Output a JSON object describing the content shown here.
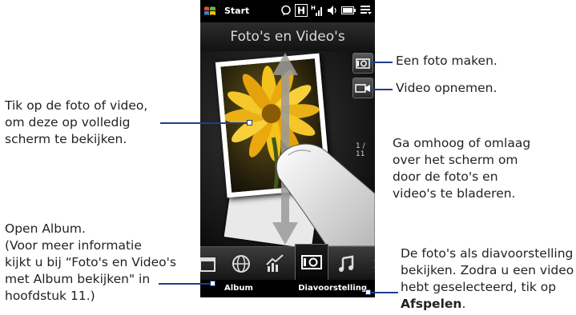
{
  "phone": {
    "status": {
      "start_label": "Start"
    },
    "title": "Foto's en Video's",
    "counter": "1 / 11",
    "softkeys": {
      "left": "Album",
      "right": "Diavoorstelling"
    }
  },
  "callouts": {
    "tap_photo": [
      "Tik op de foto of video,",
      "om deze op volledig",
      "scherm te bekijken."
    ],
    "open_album": [
      "Open Album.",
      "(Voor meer informatie",
      "kijkt u bij “Foto's en Video's",
      "met Album bekijken\" in",
      "hoofdstuk 11.)"
    ],
    "take_photo": "Een foto maken.",
    "record_video": "Video opnemen.",
    "scroll": [
      "Ga omhoog of omlaag",
      "over het scherm om",
      "door de foto's en",
      "video's te bladeren."
    ],
    "slideshow": [
      "De foto's als diavoorstelling",
      "bekijken. Zodra u een video",
      "hebt geselecteerd, tik op"
    ],
    "slideshow_bold": "Afspelen",
    "slideshow_end": "."
  },
  "colors": {
    "callout_line": "#1f3f8a",
    "text": "#231f20"
  }
}
